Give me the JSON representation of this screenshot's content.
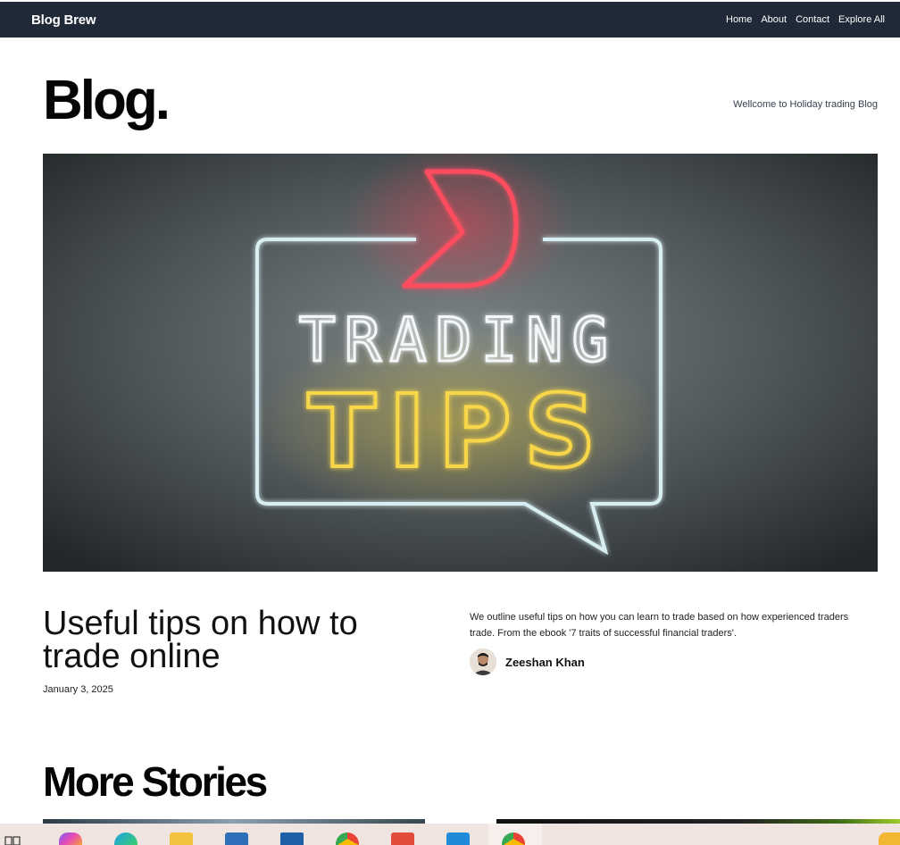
{
  "nav": {
    "brand": "Blog Brew",
    "links": [
      "Home",
      "About",
      "Contact",
      "Explore All"
    ]
  },
  "header": {
    "title": "Blog.",
    "tagline": "Wellcome to Holiday trading Blog"
  },
  "hero": {
    "sign_word_1": "TRADING",
    "sign_word_2": "TIPS"
  },
  "featured_post": {
    "title": "Useful tips on how to trade online",
    "date": "January 3, 2025",
    "excerpt": "We outline useful tips on how you can learn to trade based on how experienced traders trade. From the ebook '7 traits of successful financial traders'.",
    "author": "Zeeshan Khan"
  },
  "more_stories": {
    "title": "More Stories"
  },
  "taskbar": {
    "icons": [
      "widgets-icon",
      "copilot-icon",
      "edge-icon",
      "file-explorer-icon",
      "store-icon",
      "mail-icon",
      "chrome-icon",
      "app-icon",
      "vscode-icon",
      "chrome-active-icon",
      "notification-icon"
    ],
    "colors": {
      "background": "#efe4df"
    }
  },
  "colors": {
    "navbar": "#1f2937",
    "neon_red": "#ff4d5e",
    "neon_white": "#f4f7f8",
    "neon_yellow": "#f7d64a",
    "neon_frame": "#cfe6ea"
  }
}
